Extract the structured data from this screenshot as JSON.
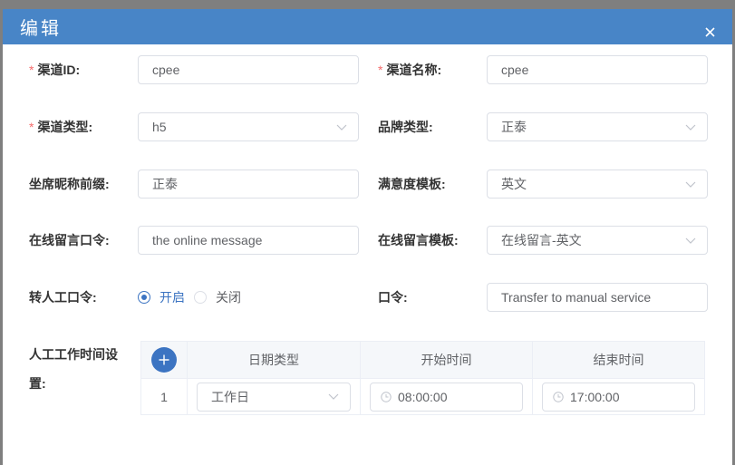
{
  "dialog": {
    "title": "编辑"
  },
  "colors": {
    "overlay": "#7f7f7f",
    "header": "#4885c7",
    "accent": "#3c74c2",
    "required": "#f56c6c"
  },
  "icons": {
    "close": "close-icon",
    "select_arrow": "chevron-down-icon",
    "add_row": "plus-icon",
    "time": "clock-icon"
  },
  "form": {
    "required_mark": "*",
    "channel_id": {
      "label": "渠道ID:",
      "required": true,
      "value": "cpee"
    },
    "channel_name": {
      "label": "渠道名称:",
      "required": true,
      "value": "cpee"
    },
    "channel_type": {
      "label": "渠道类型:",
      "required": true,
      "value": "h5"
    },
    "brand_type": {
      "label": "品牌类型:",
      "required": false,
      "value": "正泰"
    },
    "agent_nickname_prefix": {
      "label": "坐席昵称前缀:",
      "required": false,
      "value": "正泰"
    },
    "satisfaction_template": {
      "label": "满意度模板:",
      "required": false,
      "value": "英文"
    },
    "online_message_command": {
      "label": "在线留言口令:",
      "required": false,
      "value": "the online message"
    },
    "online_message_template": {
      "label": "在线留言模板:",
      "required": false,
      "value": "在线留言-英文"
    },
    "transfer_to_agent_command": {
      "label": "转人工口令:",
      "required": false,
      "options": [
        {
          "label": "开启",
          "checked": true
        },
        {
          "label": "关闭",
          "checked": false
        }
      ]
    },
    "command": {
      "label": "口令:",
      "required": false,
      "value": "Transfer to manual service"
    },
    "work_hours": {
      "label": "人工工作时间设置:",
      "columns": [
        "日期类型",
        "开始时间",
        "结束时间"
      ],
      "rows": [
        {
          "index": "1",
          "date_type": "工作日",
          "start_time": "08:00:00",
          "end_time": "17:00:00"
        }
      ]
    }
  }
}
